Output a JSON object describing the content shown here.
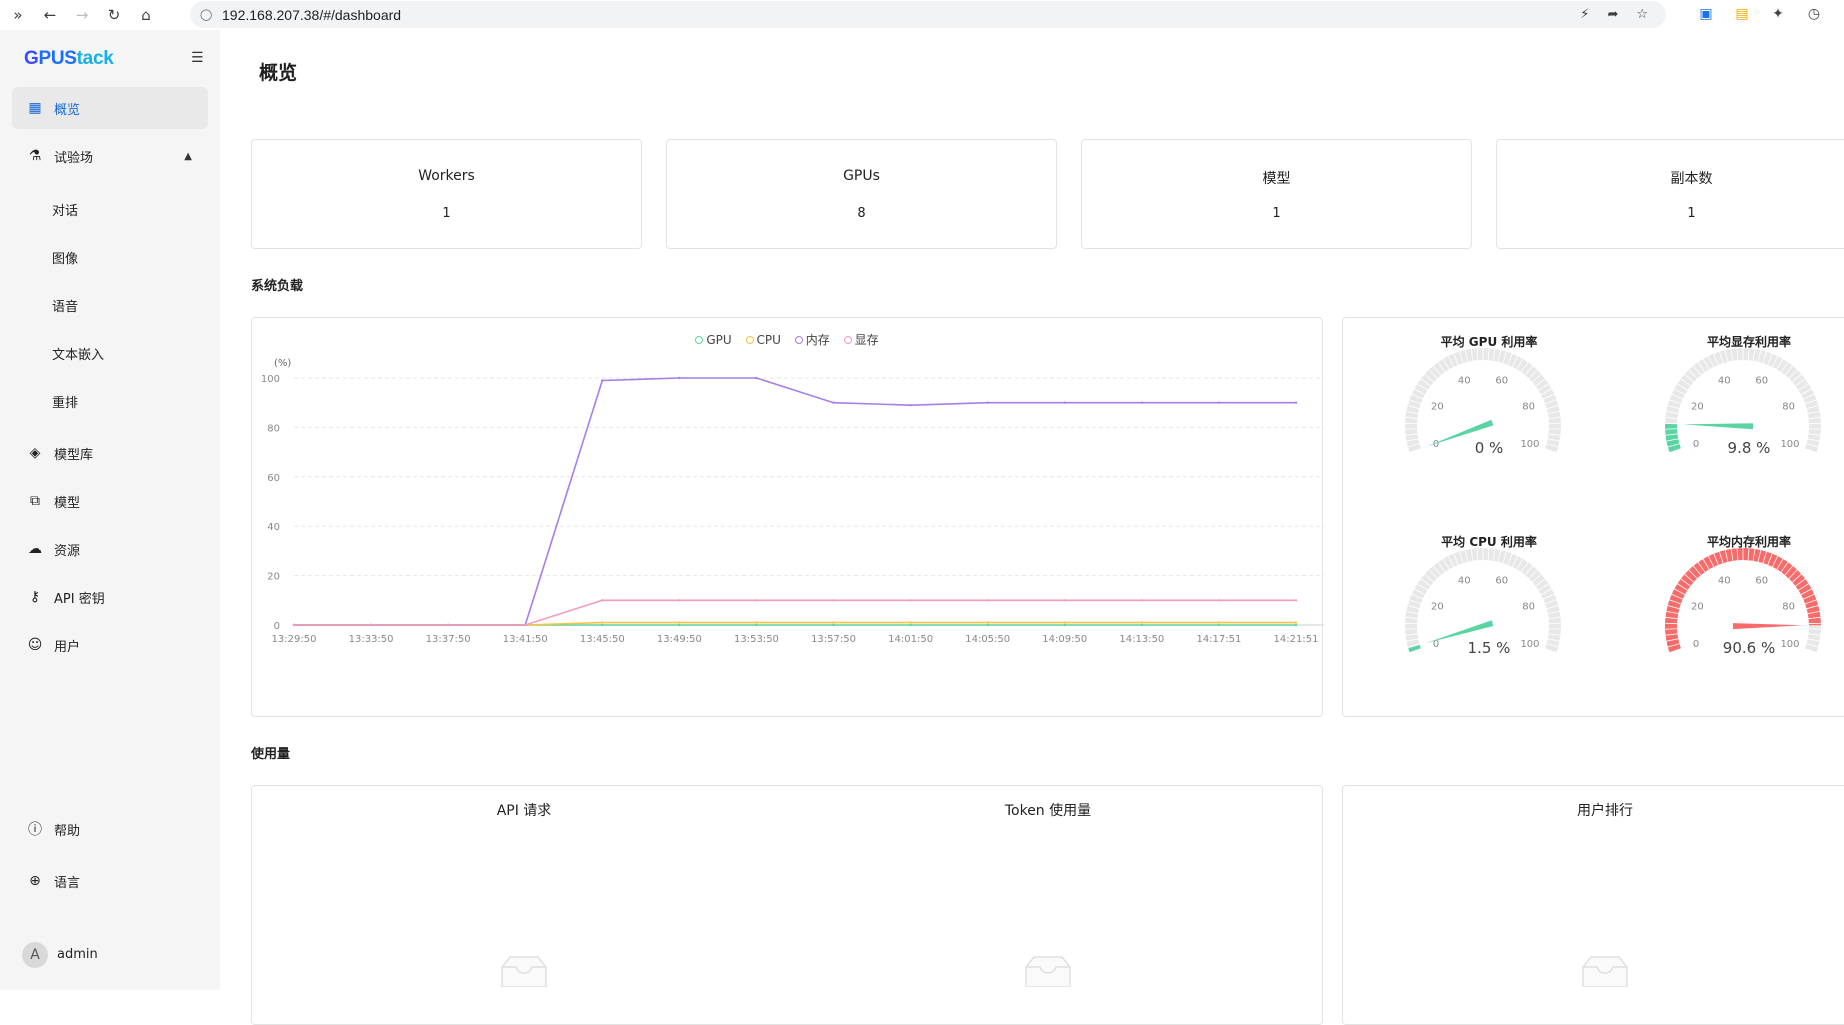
{
  "browser": {
    "url": "192.168.207.38/#/dashboard"
  },
  "sidebar": {
    "logo_g": "G",
    "logo_pus": "PUS",
    "logo_tack": "tack",
    "items": [
      {
        "label": "概览",
        "icon": "dashboard-icon"
      },
      {
        "label": "试验场",
        "icon": "flask-icon"
      },
      {
        "label": "模型库",
        "icon": "layers-icon"
      },
      {
        "label": "模型",
        "icon": "copy-icon"
      },
      {
        "label": "资源",
        "icon": "cloud-icon"
      },
      {
        "label": "API 密钥",
        "icon": "key-icon"
      },
      {
        "label": "用户",
        "icon": "user-icon"
      }
    ],
    "sub_items": [
      "对话",
      "图像",
      "语音",
      "文本嵌入",
      "重排"
    ],
    "help": "帮助",
    "language": "语言",
    "avatar_letter": "A",
    "user": "admin"
  },
  "page": {
    "title": "概览"
  },
  "stats": [
    {
      "title": "Workers",
      "value": "1"
    },
    {
      "title": "GPUs",
      "value": "8"
    },
    {
      "title": "模型",
      "value": "1"
    },
    {
      "title": "副本数",
      "value": "1"
    }
  ],
  "sections": {
    "system_load": "系统负载",
    "usage": "使用量"
  },
  "chart_data": {
    "type": "line",
    "ylabel": "(%)",
    "ylim": [
      0,
      100
    ],
    "yticks": [
      0,
      20,
      40,
      60,
      80,
      100
    ],
    "x": [
      "13:29:50",
      "13:33:50",
      "13:37:50",
      "13:41:50",
      "13:45:50",
      "13:49:50",
      "13:53:50",
      "13:57:50",
      "14:01:50",
      "14:05:50",
      "14:09:50",
      "14:13:50",
      "14:17:51",
      "14:21:51"
    ],
    "grid": true,
    "legend_position": "top-center",
    "series": [
      {
        "name": "GPU",
        "color": "#5bd4a4",
        "values": [
          0,
          0,
          0,
          0,
          0,
          0,
          0,
          0,
          0,
          0,
          0,
          0,
          0,
          0
        ]
      },
      {
        "name": "CPU",
        "color": "#f6c344",
        "values": [
          0,
          0,
          0,
          0,
          1,
          1,
          1,
          1,
          1,
          1,
          1,
          1,
          1,
          1
        ]
      },
      {
        "name": "内存",
        "color": "#a47fe8",
        "values": [
          0,
          0,
          0,
          0,
          99,
          100,
          100,
          90,
          89,
          90,
          90,
          90,
          90,
          90
        ]
      },
      {
        "name": "显存",
        "color": "#f59ab8",
        "values": [
          0,
          0,
          0,
          0,
          10,
          10,
          10,
          10,
          10,
          10,
          10,
          10,
          10,
          10
        ]
      }
    ]
  },
  "gauges": [
    {
      "title": "平均 GPU 利用率",
      "value": 0,
      "display": "0 %",
      "color": "#5bd4a4"
    },
    {
      "title": "平均显存利用率",
      "value": 9.8,
      "display": "9.8 %",
      "color": "#5bd4a4"
    },
    {
      "title": "平均 CPU 利用率",
      "value": 1.5,
      "display": "1.5 %",
      "color": "#5bd4a4"
    },
    {
      "title": "平均内存利用率",
      "value": 90.6,
      "display": "90.6 %",
      "color": "#f76b6b"
    }
  ],
  "gauge_ticks": [
    "0",
    "20",
    "40",
    "60",
    "80",
    "100"
  ],
  "usage_panels": {
    "api": "API 请求",
    "token": "Token 使用量",
    "ranking": "用户排行"
  }
}
